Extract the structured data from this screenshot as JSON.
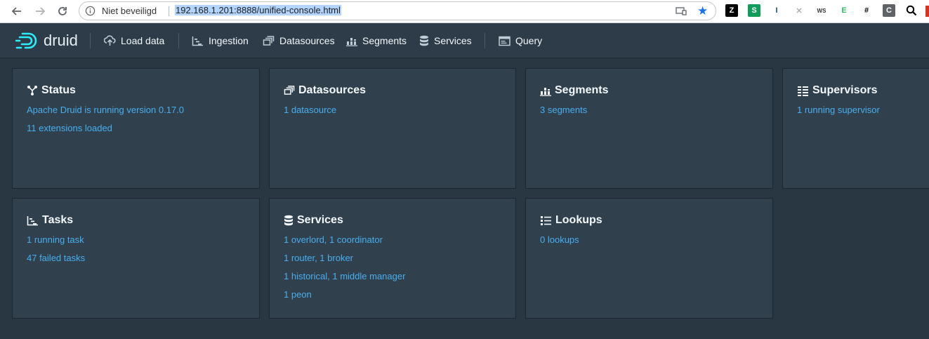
{
  "browser": {
    "security_label": "Niet beveiligd",
    "url": "192.168.1.201:8888/unified-console.html",
    "extensions": [
      {
        "icon": "zotero-icon",
        "text": "Z",
        "bg": "#000000",
        "fg": "#ffffff"
      },
      {
        "icon": "s-extension-icon",
        "text": "S",
        "bg": "#0f9d58",
        "fg": "#ffffff"
      },
      {
        "icon": "bookmark-extension-icon",
        "text": "I",
        "bg": "#ffffff",
        "fg": "#1a4f7a"
      },
      {
        "icon": "grey-extension-icon",
        "text": "✕",
        "bg": "#ffffff",
        "fg": "#b0b0b0"
      },
      {
        "icon": "ws-client-icon",
        "text": "WS",
        "bg": "#ffffff",
        "fg": "#333333"
      },
      {
        "icon": "evernote-icon",
        "text": "E",
        "bg": "#ffffff",
        "fg": "#2dbe60"
      },
      {
        "icon": "hash-icon",
        "text": "#",
        "bg": "#ffffff",
        "fg": "#000000"
      },
      {
        "icon": "c-extension-icon",
        "text": "C",
        "bg": "#5f6368",
        "fg": "#ffffff"
      }
    ]
  },
  "nav": {
    "logo": "druid",
    "items": [
      {
        "label": "Load data",
        "icon": "cloud-upload-icon"
      },
      {
        "label": "Ingestion",
        "icon": "gantt-chart-icon"
      },
      {
        "label": "Datasources",
        "icon": "multi-select-icon"
      },
      {
        "label": "Segments",
        "icon": "stacked-chart-icon"
      },
      {
        "label": "Services",
        "icon": "database-icon"
      },
      {
        "label": "Query",
        "icon": "application-icon"
      }
    ]
  },
  "cards": {
    "status": {
      "title": "Status",
      "lines": [
        "Apache Druid is running version 0.17.0",
        "11 extensions loaded"
      ]
    },
    "datasources": {
      "title": "Datasources",
      "lines": [
        "1 datasource"
      ]
    },
    "segments": {
      "title": "Segments",
      "lines": [
        "3 segments"
      ]
    },
    "supervisors": {
      "title": "Supervisors",
      "lines": [
        "1 running supervisor"
      ]
    },
    "tasks": {
      "title": "Tasks",
      "lines": [
        "1 running task",
        "47 failed tasks"
      ]
    },
    "services": {
      "title": "Services",
      "lines": [
        "1 overlord, 1 coordinator",
        "1 router, 1 broker",
        "1 historical, 1 middle manager",
        "1 peon"
      ]
    },
    "lookups": {
      "title": "Lookups",
      "lines": [
        "0 lookups"
      ]
    }
  }
}
